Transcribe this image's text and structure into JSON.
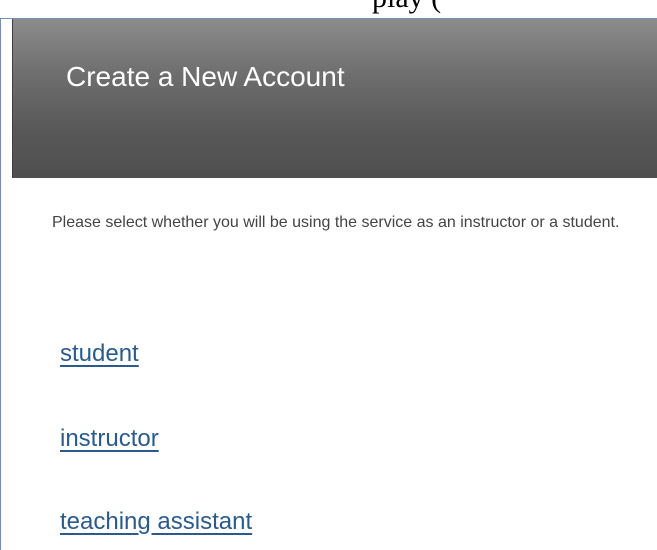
{
  "top_strip": {
    "text": "play ("
  },
  "header": {
    "title": "Create a New Account"
  },
  "main": {
    "intro_text": "Please select whether you will be using the service as an instructor or a student."
  },
  "roles": {
    "student": "student",
    "instructor": "instructor",
    "teaching_assistant": "teaching assistant"
  },
  "colors": {
    "header_gradient_top": "#8c8c8c",
    "header_gradient_bottom": "#4f4f4f",
    "link": "#2a5b8c",
    "body_text": "#444444",
    "panel_border": "#6f8fb3"
  }
}
